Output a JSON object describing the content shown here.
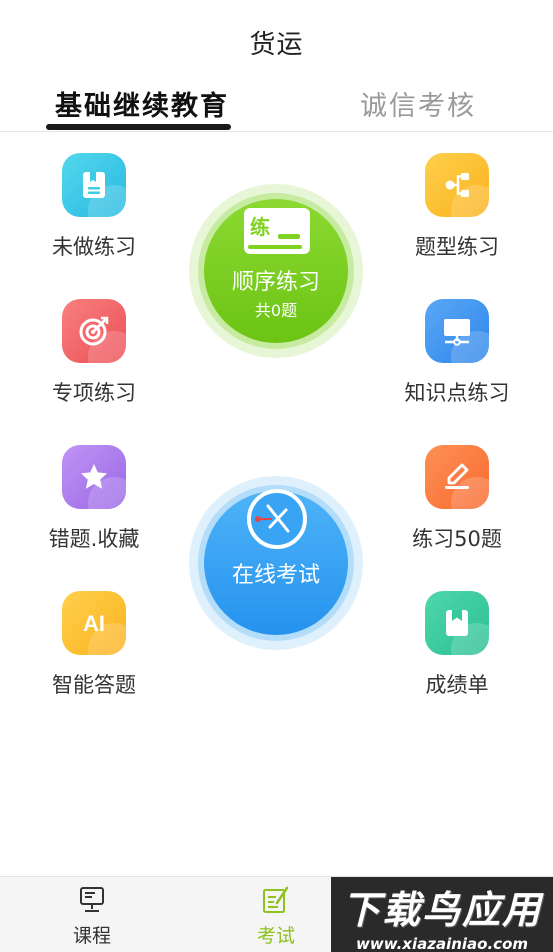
{
  "header": {
    "title": "货运"
  },
  "tabs": [
    {
      "label": "基础继续教育"
    },
    {
      "label": "诚信考核"
    }
  ],
  "grid": {
    "left": [
      {
        "label": "未做练习",
        "icon": "notebook-icon",
        "color": "#3ccbe6"
      },
      {
        "label": "专项练习",
        "icon": "target-icon",
        "color": "#f05c5c"
      },
      {
        "label": "错题.收藏",
        "icon": "star-icon",
        "color": "#a978ea"
      },
      {
        "label": "智能答题",
        "icon": "ai-icon",
        "color": "#fdbb2a"
      }
    ],
    "right": [
      {
        "label": "题型练习",
        "icon": "structure-icon",
        "color": "#fdbb2a"
      },
      {
        "label": "知识点练习",
        "icon": "monitor-icon",
        "color": "#3b8ff0"
      },
      {
        "label": "练习50题",
        "icon": "edit-icon",
        "color": "#fb7b40"
      },
      {
        "label": "成绩单",
        "icon": "bookmark-icon",
        "color": "#34ca9c"
      }
    ]
  },
  "sequential": {
    "badge": "练",
    "title": "顺序练习",
    "count": "共0题",
    "color": "#7ed321"
  },
  "exam": {
    "title": "在线考试",
    "color": "#2d9df4"
  },
  "bottom_nav": [
    {
      "label": "课程",
      "icon": "computer-icon",
      "color": "#333333"
    },
    {
      "label": "考试",
      "icon": "exam-edit-icon",
      "color": "#8dc21f"
    }
  ],
  "watermark": {
    "main": "下载鸟应用",
    "url": "www.xiazainiao.com"
  }
}
